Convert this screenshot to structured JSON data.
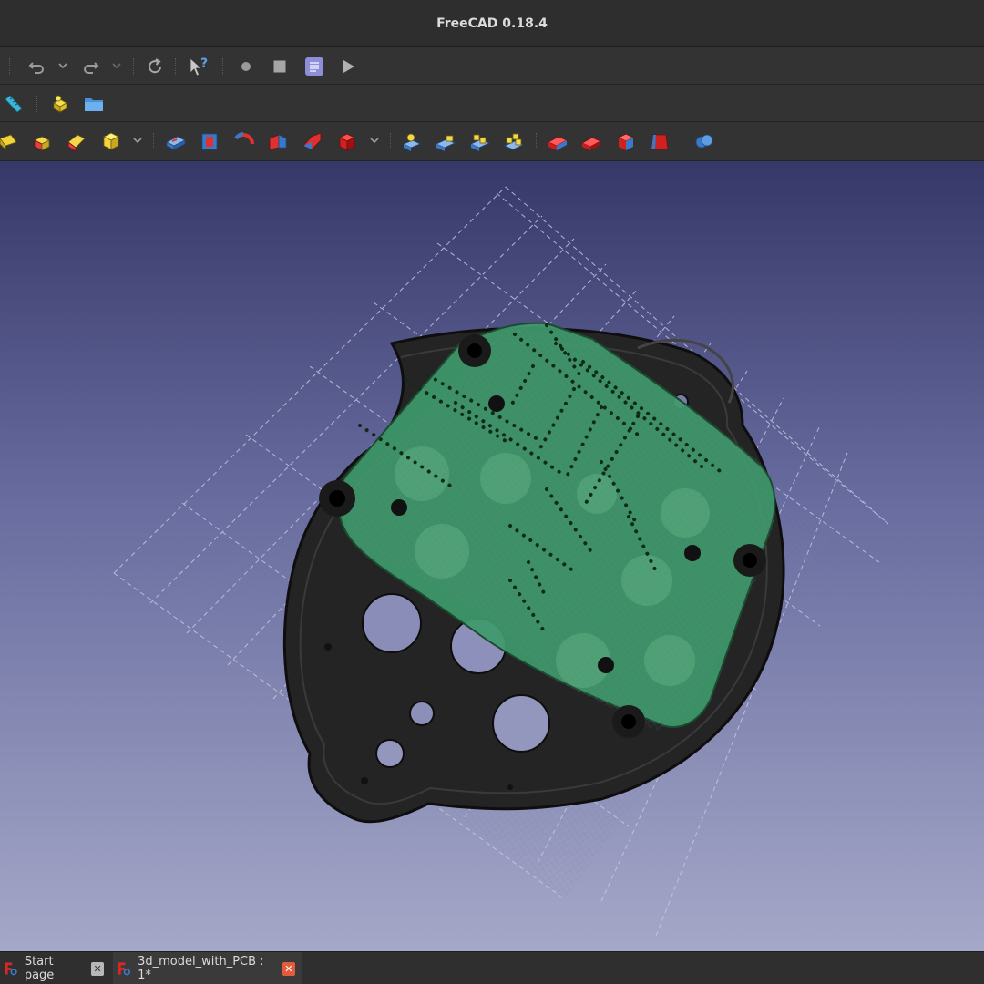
{
  "window": {
    "title": "FreeCAD 0.18.4"
  },
  "toolbar_row1": {
    "items": [
      "undo-icon",
      "redo-icon",
      "refresh-icon",
      "whats-this-icon",
      "macro-record-icon",
      "macro-stop-icon",
      "macro-edit-icon",
      "macro-run-icon"
    ]
  },
  "toolbar_row2": {
    "items": [
      "measure-icon",
      "part-icon",
      "open-folder-icon"
    ]
  },
  "toolbar_row3": {
    "items": [
      "cylinder-icon",
      "box-icon",
      "chamfer-icon",
      "cube-icon",
      "pad-icon",
      "pocket-icon",
      "revolution-icon",
      "groove-icon",
      "loft-icon",
      "subtractive-icon",
      "boolean-cut-icon",
      "boolean-union-icon",
      "boolean-common-icon",
      "boolean-multi-icon",
      "fillet-icon",
      "chamfer2-icon",
      "thickness-icon",
      "draft-icon",
      "shape-binder-icon"
    ]
  },
  "tabs": [
    {
      "label": "Start page",
      "active": false
    },
    {
      "label": "3d_model_with_PCB : 1*",
      "active": true
    }
  ],
  "colors": {
    "viewport_top": "#37386a",
    "viewport_bottom": "#a5a8c8",
    "pcb": "#3f9a6b",
    "housing": "#232323",
    "close_active": "#e25b3a"
  }
}
